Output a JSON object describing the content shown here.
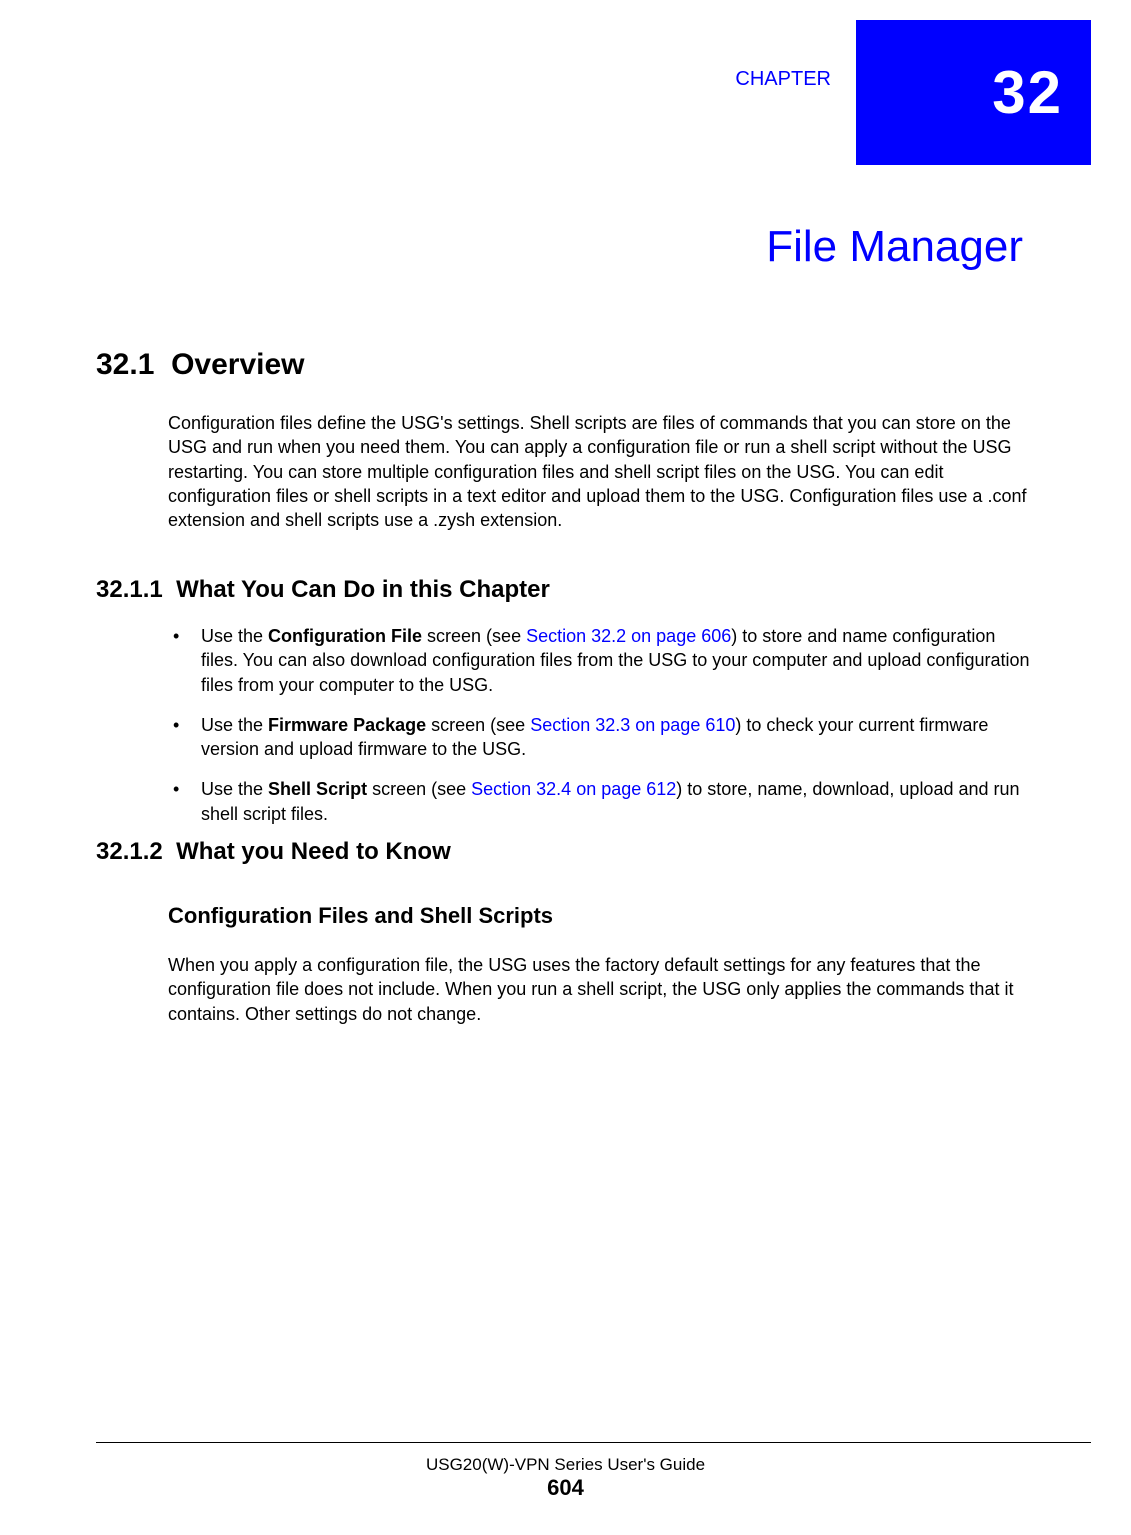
{
  "chapter": {
    "label": "CHAPTER",
    "number": "32",
    "title": "File Manager"
  },
  "sections": {
    "s321": {
      "num": "32.1",
      "title": "Overview",
      "para": "Configuration files define the USG's settings. Shell scripts are files of commands that you can store on the USG and run when you need them. You can apply a configuration file or run a shell script without the USG restarting. You can store multiple configuration files and shell script files on the USG. You can edit configuration files or shell scripts in a text editor and upload them to the USG. Configuration files use a .conf extension and shell scripts use a .zysh extension."
    },
    "s3211": {
      "num": "32.1.1",
      "title": "What You Can Do in this Chapter",
      "bullets": [
        {
          "pre": "Use the ",
          "bold": "Configuration File",
          "mid": " screen (see ",
          "link": "Section 32.2 on page 606",
          "post": ") to store and name configuration files. You can also download configuration files from the USG to your computer and upload configuration files from your computer to the USG."
        },
        {
          "pre": "Use the ",
          "bold": "Firmware Package",
          "mid": " screen (see ",
          "link": "Section 32.3 on page 610",
          "post": ") to check your current firmware version and upload firmware to the USG."
        },
        {
          "pre": "Use the ",
          "bold": "Shell Script",
          "mid": " screen (see ",
          "link": "Section 32.4 on page 612",
          "post": ") to store, name, download, upload and run shell script files."
        }
      ]
    },
    "s3212": {
      "num": "32.1.2",
      "title": "What you Need to Know",
      "sub": {
        "title": "Configuration Files and Shell Scripts",
        "para": "When you apply a configuration file, the USG uses the factory default settings for any features that the configuration file does not include. When you run a shell script, the USG only applies the commands that it contains. Other settings do not change."
      }
    }
  },
  "footer": {
    "guide": "USG20(W)-VPN Series User's Guide",
    "page": "604"
  }
}
